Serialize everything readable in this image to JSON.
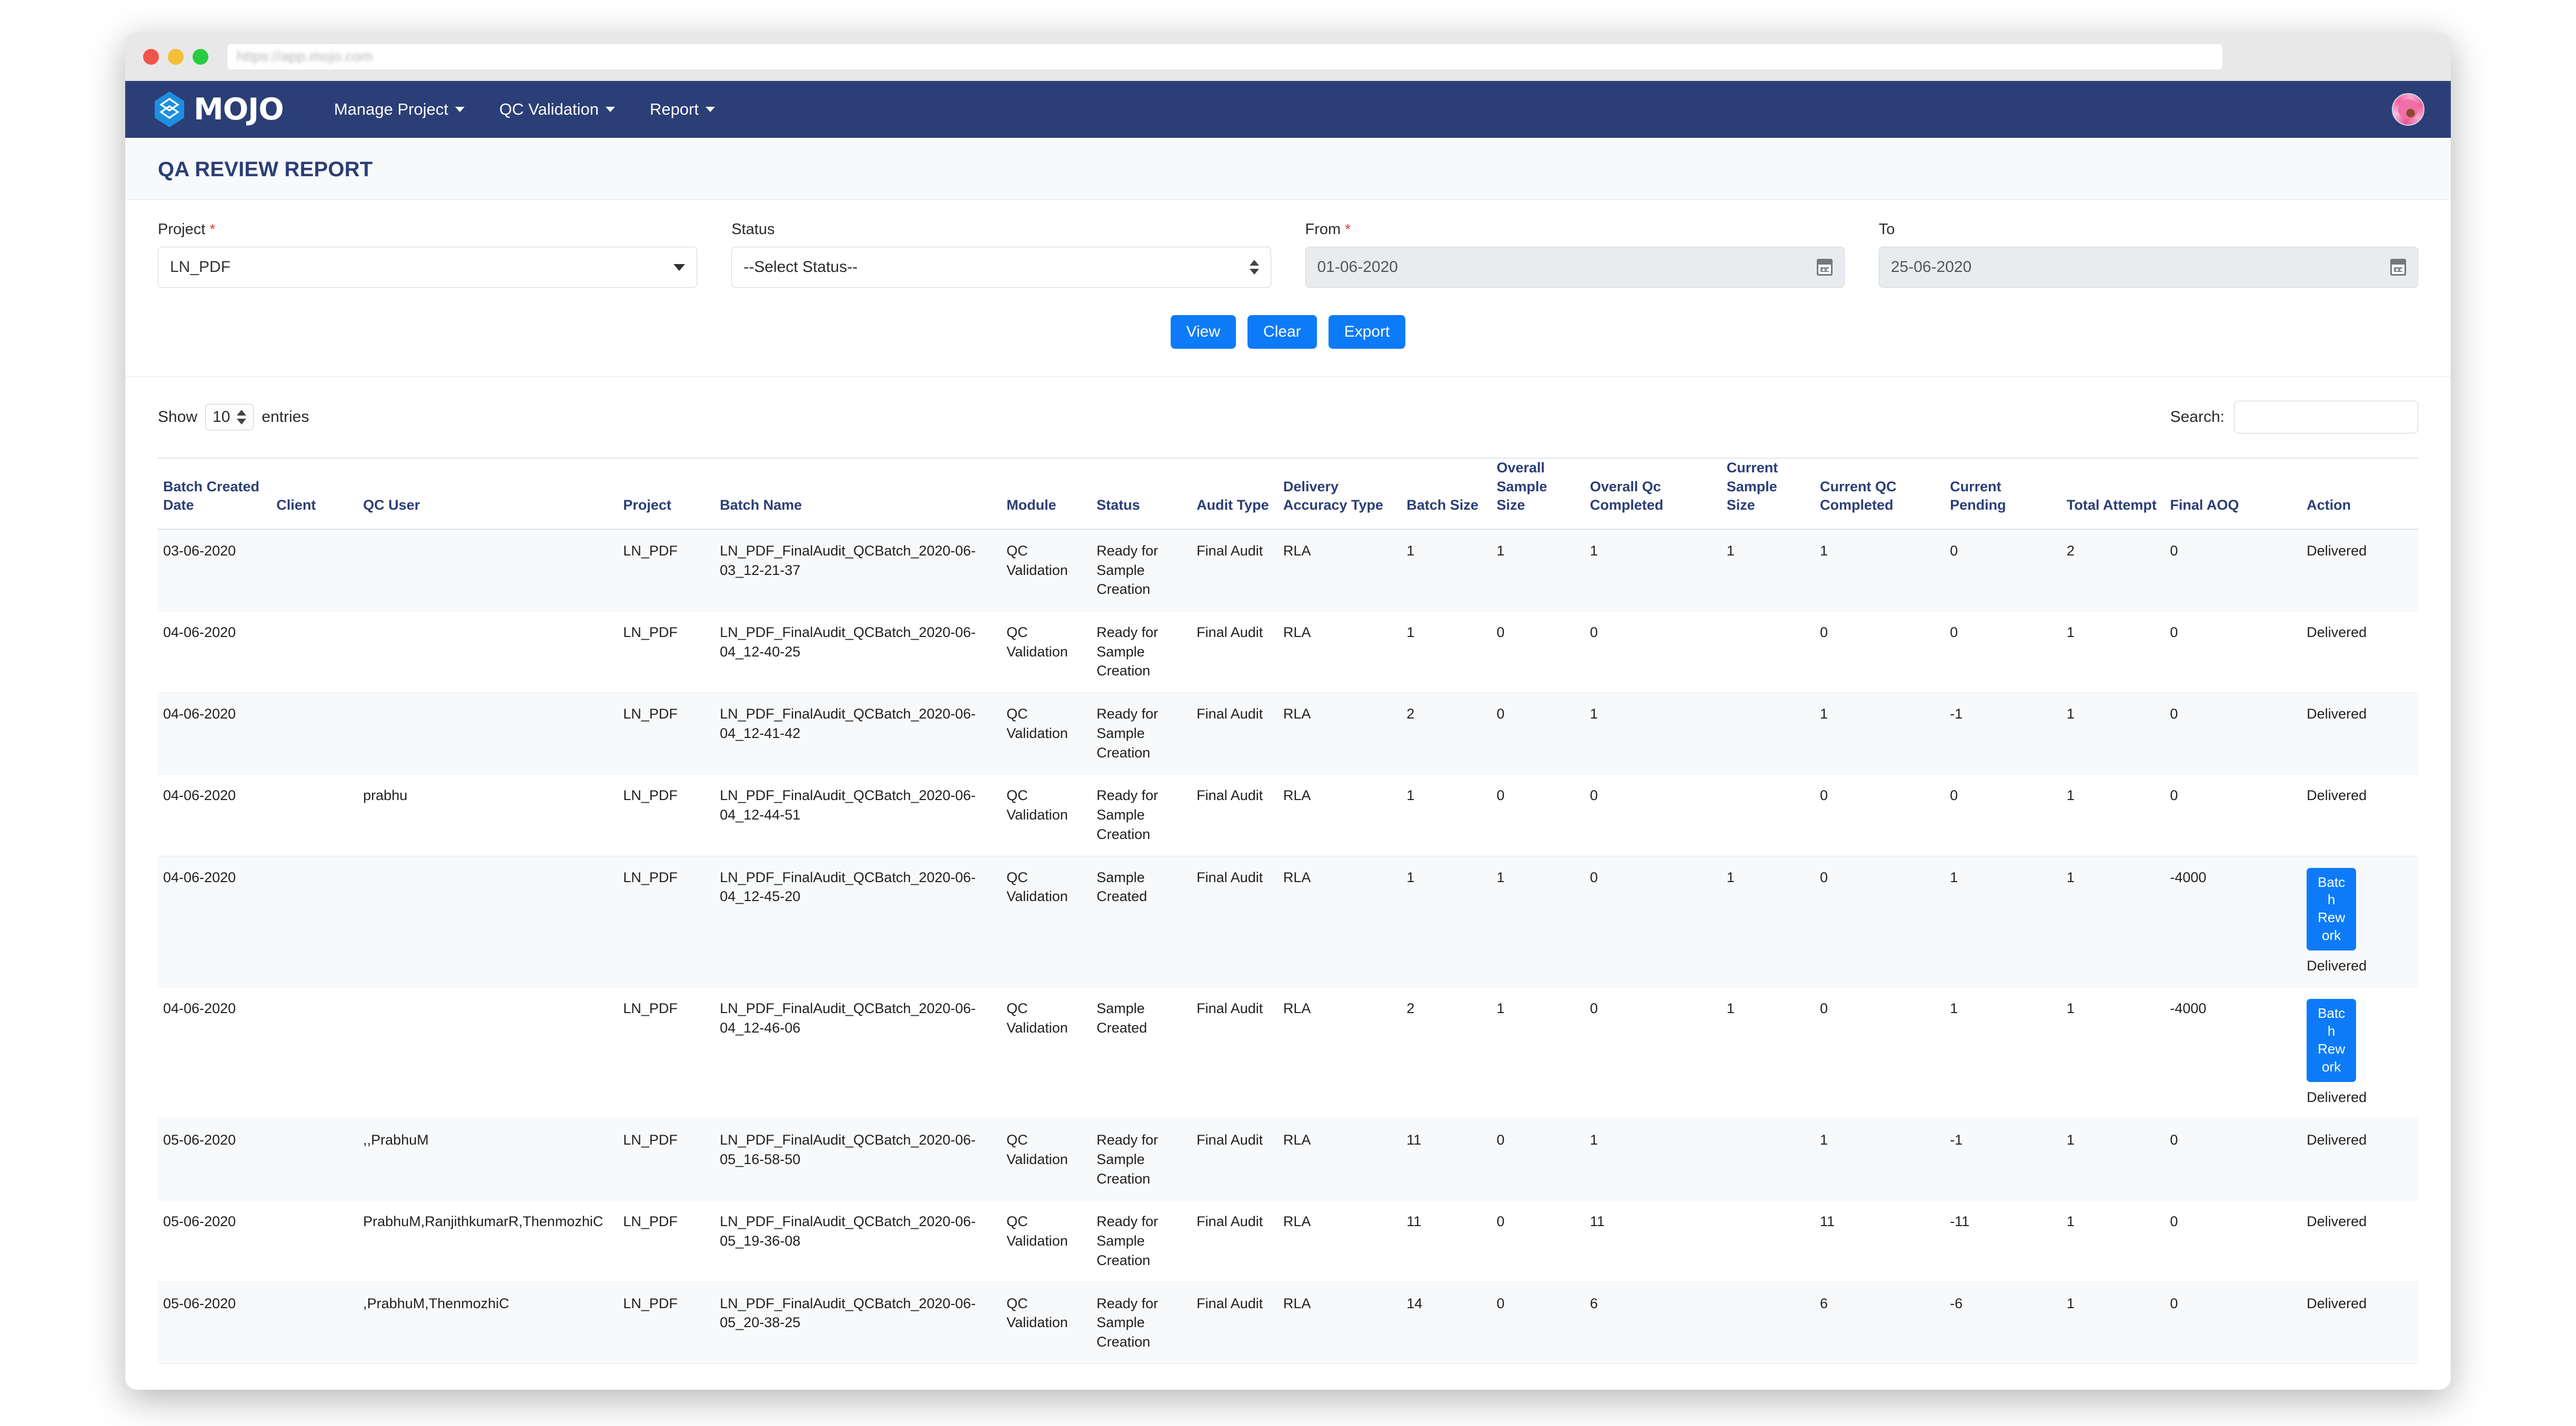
{
  "browser": {
    "url": "https://app.mojo.com"
  },
  "navbar": {
    "brand": "MOJO",
    "brand_icon": "mojo-leaf-logo",
    "links": [
      {
        "label": "Manage Project",
        "icon": "chevron-down-icon"
      },
      {
        "label": "QC Validation",
        "icon": "chevron-down-icon"
      },
      {
        "label": "Report",
        "icon": "chevron-down-icon"
      }
    ],
    "avatar_icon": "user-avatar-flower"
  },
  "page": {
    "title": "QA REVIEW REPORT"
  },
  "filters": {
    "project": {
      "label": "Project",
      "required": "*",
      "value": "LN_PDF"
    },
    "status": {
      "label": "Status",
      "required": "",
      "value": "--Select Status--"
    },
    "from": {
      "label": "From",
      "required": "*",
      "value": "01-06-2020",
      "icon": "calendar-icon"
    },
    "to": {
      "label": "To",
      "required": "",
      "value": "25-06-2020",
      "icon": "calendar-icon"
    },
    "buttons": {
      "view": "View",
      "clear": "Clear",
      "export": "Export"
    }
  },
  "table_controls": {
    "show_label": "Show",
    "entries_value": "10",
    "entries_label": "entries",
    "search_label": "Search:",
    "search_value": "",
    "search_placeholder": ""
  },
  "table": {
    "columns": [
      "Batch Created Date",
      "Client",
      "QC User",
      "Project",
      "Batch Name",
      "Module",
      "Status",
      "Audit Type",
      "Delivery Accuracy Type",
      "Batch Size",
      "Overall Sample Size",
      "Overall Qc Completed",
      "Current Sample Size",
      "Current QC Completed",
      "Current Pending",
      "Total Attempt",
      "Final AOQ",
      "Action"
    ],
    "rows": [
      {
        "date": "03-06-2020",
        "client": "",
        "qc_user": "",
        "project": "LN_PDF",
        "batch_name": "LN_PDF_FinalAudit_QCBatch_2020-06-03_12-21-37",
        "module": "QC Validation",
        "status": "Ready for Sample Creation",
        "audit_type": "Final Audit",
        "delivery_accuracy_type": "RLA",
        "batch_size": "1",
        "overall_sample_size": "1",
        "overall_qc_completed": "1",
        "current_sample_size": "1",
        "current_qc_completed": "1",
        "current_pending": "0",
        "total_attempt": "2",
        "final_aoq": "0",
        "action_button": "",
        "action_text": "Delivered"
      },
      {
        "date": "04-06-2020",
        "client": "",
        "qc_user": "",
        "project": "LN_PDF",
        "batch_name": "LN_PDF_FinalAudit_QCBatch_2020-06-04_12-40-25",
        "module": "QC Validation",
        "status": "Ready for Sample Creation",
        "audit_type": "Final Audit",
        "delivery_accuracy_type": "RLA",
        "batch_size": "1",
        "overall_sample_size": "0",
        "overall_qc_completed": "0",
        "current_sample_size": "",
        "current_qc_completed": "0",
        "current_pending": "0",
        "total_attempt": "1",
        "final_aoq": "0",
        "action_button": "",
        "action_text": "Delivered"
      },
      {
        "date": "04-06-2020",
        "client": "",
        "qc_user": "",
        "project": "LN_PDF",
        "batch_name": "LN_PDF_FinalAudit_QCBatch_2020-06-04_12-41-42",
        "module": "QC Validation",
        "status": "Ready for Sample Creation",
        "audit_type": "Final Audit",
        "delivery_accuracy_type": "RLA",
        "batch_size": "2",
        "overall_sample_size": "0",
        "overall_qc_completed": "1",
        "current_sample_size": "",
        "current_qc_completed": "1",
        "current_pending": "-1",
        "total_attempt": "1",
        "final_aoq": "0",
        "action_button": "",
        "action_text": "Delivered"
      },
      {
        "date": "04-06-2020",
        "client": "",
        "qc_user": "prabhu",
        "project": "LN_PDF",
        "batch_name": "LN_PDF_FinalAudit_QCBatch_2020-06-04_12-44-51",
        "module": "QC Validation",
        "status": "Ready for Sample Creation",
        "audit_type": "Final Audit",
        "delivery_accuracy_type": "RLA",
        "batch_size": "1",
        "overall_sample_size": "0",
        "overall_qc_completed": "0",
        "current_sample_size": "",
        "current_qc_completed": "0",
        "current_pending": "0",
        "total_attempt": "1",
        "final_aoq": "0",
        "action_button": "",
        "action_text": "Delivered"
      },
      {
        "date": "04-06-2020",
        "client": "",
        "qc_user": "",
        "project": "LN_PDF",
        "batch_name": "LN_PDF_FinalAudit_QCBatch_2020-06-04_12-45-20",
        "module": "QC Validation",
        "status": "Sample Created",
        "audit_type": "Final Audit",
        "delivery_accuracy_type": "RLA",
        "batch_size": "1",
        "overall_sample_size": "1",
        "overall_qc_completed": "0",
        "current_sample_size": "1",
        "current_qc_completed": "0",
        "current_pending": "1",
        "total_attempt": "1",
        "final_aoq": "-4000",
        "action_button": "Batch Rework",
        "action_text": "Delivered"
      },
      {
        "date": "04-06-2020",
        "client": "",
        "qc_user": "",
        "project": "LN_PDF",
        "batch_name": "LN_PDF_FinalAudit_QCBatch_2020-06-04_12-46-06",
        "module": "QC Validation",
        "status": "Sample Created",
        "audit_type": "Final Audit",
        "delivery_accuracy_type": "RLA",
        "batch_size": "2",
        "overall_sample_size": "1",
        "overall_qc_completed": "0",
        "current_sample_size": "1",
        "current_qc_completed": "0",
        "current_pending": "1",
        "total_attempt": "1",
        "final_aoq": "-4000",
        "action_button": "Batch Rework",
        "action_text": "Delivered"
      },
      {
        "date": "05-06-2020",
        "client": "",
        "qc_user": ",,PrabhuM",
        "project": "LN_PDF",
        "batch_name": "LN_PDF_FinalAudit_QCBatch_2020-06-05_16-58-50",
        "module": "QC Validation",
        "status": "Ready for Sample Creation",
        "audit_type": "Final Audit",
        "delivery_accuracy_type": "RLA",
        "batch_size": "11",
        "overall_sample_size": "0",
        "overall_qc_completed": "1",
        "current_sample_size": "",
        "current_qc_completed": "1",
        "current_pending": "-1",
        "total_attempt": "1",
        "final_aoq": "0",
        "action_button": "",
        "action_text": "Delivered"
      },
      {
        "date": "05-06-2020",
        "client": "",
        "qc_user": "PrabhuM,RanjithkumarR,ThenmozhiC",
        "project": "LN_PDF",
        "batch_name": "LN_PDF_FinalAudit_QCBatch_2020-06-05_19-36-08",
        "module": "QC Validation",
        "status": "Ready for Sample Creation",
        "audit_type": "Final Audit",
        "delivery_accuracy_type": "RLA",
        "batch_size": "11",
        "overall_sample_size": "0",
        "overall_qc_completed": "11",
        "current_sample_size": "",
        "current_qc_completed": "11",
        "current_pending": "-11",
        "total_attempt": "1",
        "final_aoq": "0",
        "action_button": "",
        "action_text": "Delivered"
      },
      {
        "date": "05-06-2020",
        "client": "",
        "qc_user": ",PrabhuM,ThenmozhiC",
        "project": "LN_PDF",
        "batch_name": "LN_PDF_FinalAudit_QCBatch_2020-06-05_20-38-25",
        "module": "QC Validation",
        "status": "Ready for Sample Creation",
        "audit_type": "Final Audit",
        "delivery_accuracy_type": "RLA",
        "batch_size": "14",
        "overall_sample_size": "0",
        "overall_qc_completed": "6",
        "current_sample_size": "",
        "current_qc_completed": "6",
        "current_pending": "-6",
        "total_attempt": "1",
        "final_aoq": "0",
        "action_button": "",
        "action_text": "Delivered"
      }
    ]
  },
  "colors": {
    "navbar": "#2b3e76",
    "accent_blue": "#0d7bf7",
    "header_text": "#2b3e76",
    "required_star": "#e23b3b"
  }
}
